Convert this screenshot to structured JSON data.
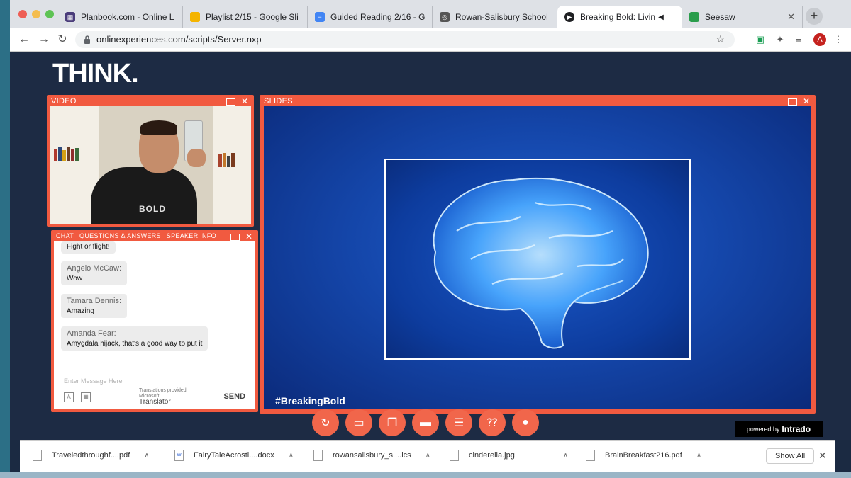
{
  "tabs": [
    {
      "label": "Planbook.com - Online L",
      "color": "#4a3c7a"
    },
    {
      "label": "Playlist 2/15 - Google Sli",
      "color": "#f4b400"
    },
    {
      "label": "Guided Reading 2/16 - G",
      "color": "#4285f4"
    },
    {
      "label": "Rowan-Salisbury School",
      "color": "#333333"
    },
    {
      "label": "Breaking Bold: Livin",
      "color": "#202124"
    },
    {
      "label": "Seesaw",
      "color": "#2a9d4c"
    }
  ],
  "url": "onlinexperiences.com/scripts/Server.nxp",
  "avatar_letter": "A",
  "logo": "THINK.",
  "video": {
    "title": "VIDEO",
    "shirt_text": "BOLD"
  },
  "chat": {
    "tabs": [
      "CHAT",
      "QUESTIONS & ANSWERS",
      "SPEAKER INFO"
    ],
    "messages": [
      {
        "author": "",
        "text": "Fight or flight!"
      },
      {
        "author": "Angelo McCaw:",
        "text": "Wow"
      },
      {
        "author": "Tamara Dennis:",
        "text": "Amazing"
      },
      {
        "author": "Amanda Fear:",
        "text": "Amygdala hijack, that's a good way to put it"
      }
    ],
    "input_placeholder": "Enter Message Here",
    "translations_line1": "Translations provided",
    "translations_brand": "Microsoft",
    "translations_line2": "Translator",
    "send": "SEND"
  },
  "slides": {
    "title": "SLIDES",
    "hashtag": "#BreakingBold"
  },
  "controls": [
    "refresh-icon",
    "video-icon",
    "slides-icon",
    "chat-icon",
    "list-icon",
    "qa-icon",
    "person-icon"
  ],
  "powered_by": {
    "prefix": "powered by",
    "brand": "Intrado"
  },
  "downloads": [
    {
      "name": "Traveledthroughf....pdf"
    },
    {
      "name": "FairyTaleAcrosti....docx"
    },
    {
      "name": "rowansalisbury_s....ics"
    },
    {
      "name": "cinderella.jpg"
    },
    {
      "name": "BrainBreakfast216.pdf"
    }
  ],
  "show_all": "Show All",
  "colors": {
    "accent": "#f15a40",
    "page_bg": "#1d2b44"
  }
}
